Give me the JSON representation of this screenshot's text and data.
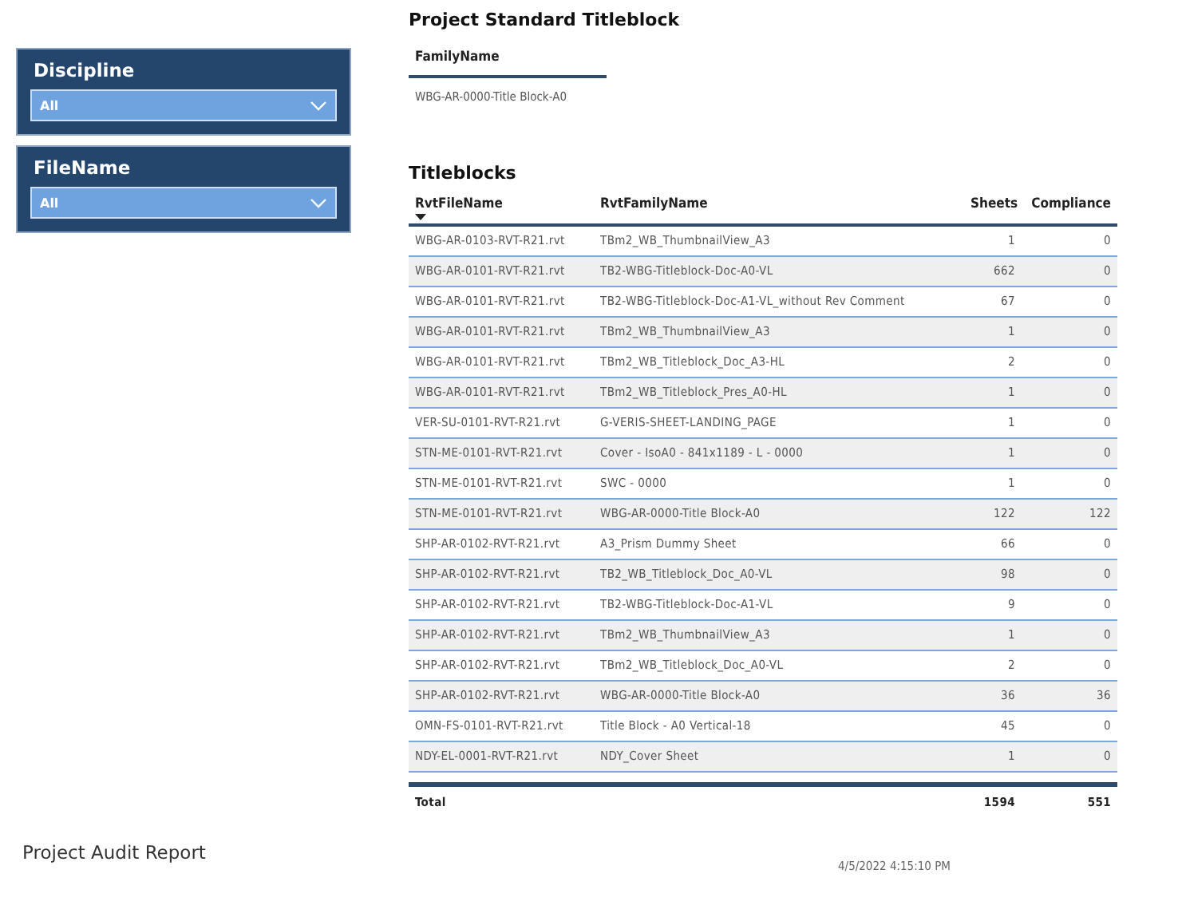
{
  "slicers": [
    {
      "title": "Discipline",
      "value": "All"
    },
    {
      "title": "FileName",
      "value": "All"
    }
  ],
  "standard": {
    "title": "Project Standard Titleblock",
    "column": "FamilyName",
    "value": "WBG-AR-0000-Title Block-A0"
  },
  "titleblocks": {
    "title": "Titleblocks",
    "columns": [
      {
        "label": "RvtFileName",
        "kind": "text",
        "sorted": true
      },
      {
        "label": "RvtFamilyName",
        "kind": "text",
        "sorted": false
      },
      {
        "label": "Sheets",
        "kind": "number",
        "sorted": false
      },
      {
        "label": "Compliance",
        "kind": "number",
        "sorted": false
      }
    ],
    "rows": [
      [
        "WBG-AR-0103-RVT-R21.rvt",
        "TBm2_WB_ThumbnailView_A3",
        "1",
        "0"
      ],
      [
        "WBG-AR-0101-RVT-R21.rvt",
        "TB2-WBG-Titleblock-Doc-A0-VL",
        "662",
        "0"
      ],
      [
        "WBG-AR-0101-RVT-R21.rvt",
        "TB2-WBG-Titleblock-Doc-A1-VL_without Rev Comment",
        "67",
        "0"
      ],
      [
        "WBG-AR-0101-RVT-R21.rvt",
        "TBm2_WB_ThumbnailView_A3",
        "1",
        "0"
      ],
      [
        "WBG-AR-0101-RVT-R21.rvt",
        "TBm2_WB_Titleblock_Doc_A3-HL",
        "2",
        "0"
      ],
      [
        "WBG-AR-0101-RVT-R21.rvt",
        "TBm2_WB_Titleblock_Pres_A0-HL",
        "1",
        "0"
      ],
      [
        "VER-SU-0101-RVT-R21.rvt",
        "G-VERIS-SHEET-LANDING_PAGE",
        "1",
        "0"
      ],
      [
        "STN-ME-0101-RVT-R21.rvt",
        "Cover - IsoA0 - 841x1189 - L - 0000",
        "1",
        "0"
      ],
      [
        "STN-ME-0101-RVT-R21.rvt",
        "SWC - 0000",
        "1",
        "0"
      ],
      [
        "STN-ME-0101-RVT-R21.rvt",
        "WBG-AR-0000-Title Block-A0",
        "122",
        "122"
      ],
      [
        "SHP-AR-0102-RVT-R21.rvt",
        "A3_Prism Dummy Sheet",
        "66",
        "0"
      ],
      [
        "SHP-AR-0102-RVT-R21.rvt",
        "TB2_WB_Titleblock_Doc_A0-VL",
        "98",
        "0"
      ],
      [
        "SHP-AR-0102-RVT-R21.rvt",
        "TB2-WBG-Titleblock-Doc-A1-VL",
        "9",
        "0"
      ],
      [
        "SHP-AR-0102-RVT-R21.rvt",
        "TBm2_WB_ThumbnailView_A3",
        "1",
        "0"
      ],
      [
        "SHP-AR-0102-RVT-R21.rvt",
        "TBm2_WB_Titleblock_Doc_A0-VL",
        "2",
        "0"
      ],
      [
        "SHP-AR-0102-RVT-R21.rvt",
        "WBG-AR-0000-Title Block-A0",
        "36",
        "36"
      ],
      [
        "OMN-FS-0101-RVT-R21.rvt",
        "Title Block - A0 Vertical-18",
        "45",
        "0"
      ],
      [
        "NDY-EL-0001-RVT-R21.rvt",
        "NDY_Cover Sheet",
        "1",
        "0"
      ]
    ],
    "total": {
      "label": "Total",
      "values": [
        "1594",
        "551"
      ]
    }
  },
  "footer": {
    "title": "Project Audit Report",
    "timestamp": "4/5/2022 4:15:10 PM"
  }
}
